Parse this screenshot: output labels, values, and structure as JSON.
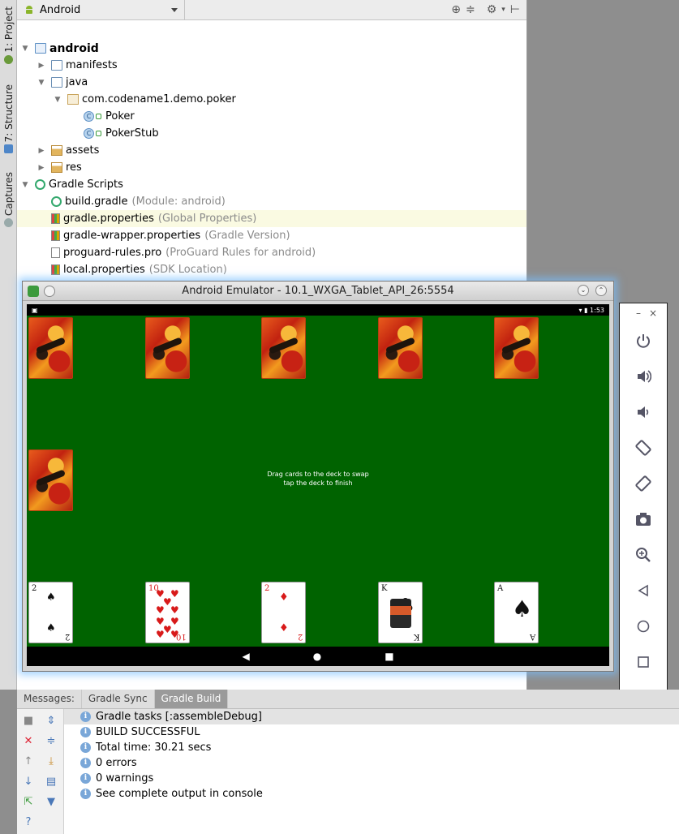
{
  "vertical_tabs": [
    "1: Project",
    "7: Structure",
    "Captures"
  ],
  "project": {
    "view": "Android",
    "tree": [
      {
        "label": "android",
        "kind": "module",
        "depth": 0,
        "expanded": true
      },
      {
        "label": "manifests",
        "kind": "folder",
        "depth": 1,
        "expanded": false
      },
      {
        "label": "java",
        "kind": "folder",
        "depth": 1,
        "expanded": true
      },
      {
        "label": "com.codename1.demo.poker",
        "kind": "package",
        "depth": 2,
        "expanded": true
      },
      {
        "label": "Poker",
        "kind": "class",
        "depth": 3
      },
      {
        "label": "PokerStub",
        "kind": "class",
        "depth": 3
      },
      {
        "label": "assets",
        "kind": "res-folder",
        "depth": 1,
        "expanded": false
      },
      {
        "label": "res",
        "kind": "res-folder",
        "depth": 1,
        "expanded": false
      },
      {
        "label": "Gradle Scripts",
        "kind": "gradle",
        "depth": 0,
        "expanded": true
      },
      {
        "label": "build.gradle",
        "note": "(Module: android)",
        "kind": "gradle",
        "depth": 1
      },
      {
        "label": "gradle.properties",
        "note": "(Global Properties)",
        "kind": "props",
        "depth": 1,
        "highlight": true
      },
      {
        "label": "gradle-wrapper.properties",
        "note": "(Gradle Version)",
        "kind": "props",
        "depth": 1
      },
      {
        "label": "proguard-rules.pro",
        "note": "(ProGuard Rules for android)",
        "kind": "file",
        "depth": 1
      },
      {
        "label": "local.properties",
        "note": "(SDK Location)",
        "kind": "props",
        "depth": 1
      }
    ]
  },
  "emulator": {
    "title": "Android Emulator - 10.1_WXGA_Tablet_API_26:5554",
    "time": "1:53",
    "prompt_line1": "Drag cards to the deck to swap",
    "prompt_line2": "tap the deck to finish",
    "hand": [
      {
        "rank": "2",
        "suit": "♠",
        "color": "black"
      },
      {
        "rank": "10",
        "suit": "♥",
        "color": "red"
      },
      {
        "rank": "2",
        "suit": "♦",
        "color": "red"
      },
      {
        "rank": "K",
        "suit": "♣",
        "color": "black"
      },
      {
        "rank": "A",
        "suit": "♠",
        "color": "black"
      }
    ],
    "nav": [
      "◀",
      "●",
      "■"
    ]
  },
  "side_panel": {
    "min": "–",
    "close": "×",
    "buttons": [
      "power-icon",
      "volume-up-icon",
      "volume-down-icon",
      "rotate-left-icon",
      "rotate-right-icon",
      "camera-icon",
      "zoom-icon",
      "back-icon",
      "home-icon",
      "overview-icon",
      "more-icon"
    ]
  },
  "messages": {
    "label": "Messages:",
    "tabs": [
      "Gradle Sync",
      "Gradle Build"
    ],
    "active_tab": "Gradle Build",
    "rows": [
      "Gradle tasks [:assembleDebug]",
      "BUILD SUCCESSFUL",
      "Total time: 30.21 secs",
      "0 errors",
      "0 warnings",
      "See complete output in console"
    ]
  },
  "colors": {
    "felt": "#006300",
    "accent": "#3d9a3d",
    "info": "#7aa7d8"
  }
}
